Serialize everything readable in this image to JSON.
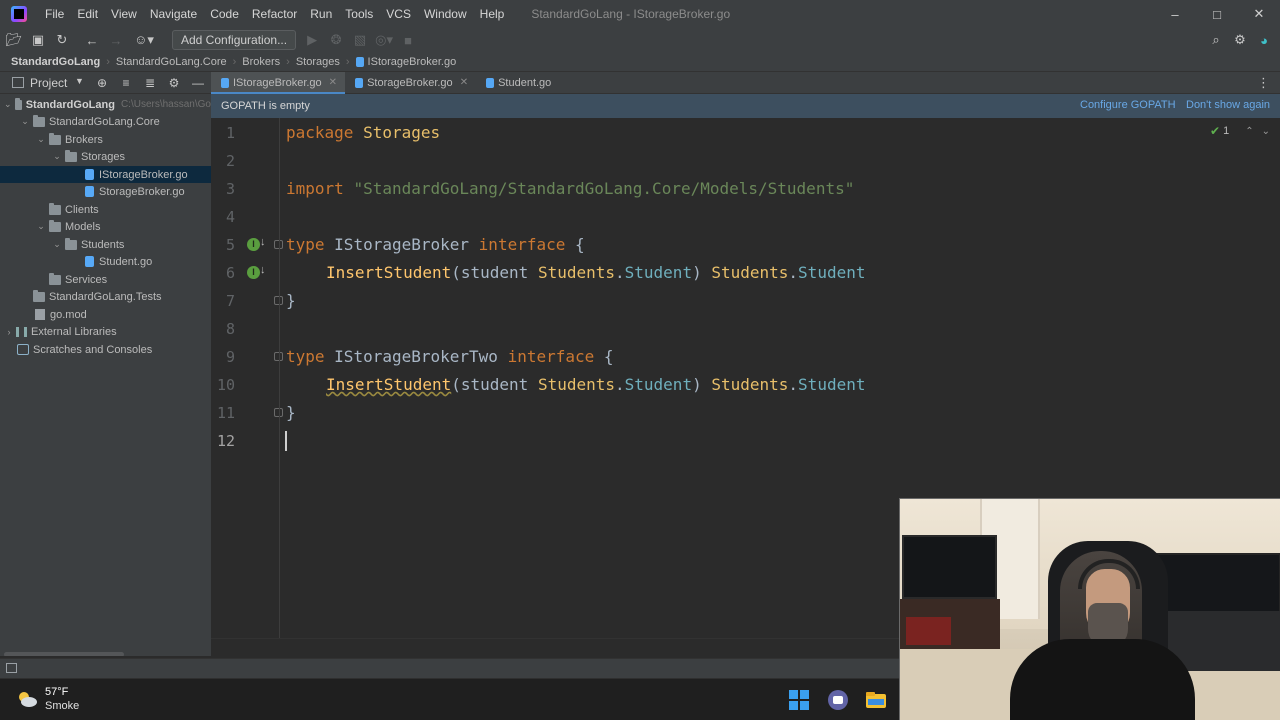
{
  "app": {
    "window_title": "StandardGoLang - IStorageBroker.go",
    "menu": [
      "File",
      "Edit",
      "View",
      "Navigate",
      "Code",
      "Refactor",
      "Run",
      "Tools",
      "VCS",
      "Window",
      "Help"
    ]
  },
  "toolbar": {
    "add_configuration": "Add Configuration..."
  },
  "breadcrumb": [
    "StandardGoLang",
    "StandardGoLang.Core",
    "Brokers",
    "Storages",
    "IStorageBroker.go"
  ],
  "project_panel": {
    "title": "Project",
    "tree": [
      {
        "label": "StandardGoLang",
        "path": "C:\\Users\\hassan\\Go",
        "icon": "folder-icon",
        "expanded": true
      },
      {
        "label": "StandardGoLang.Core",
        "icon": "folder-icon",
        "expanded": true
      },
      {
        "label": "Brokers",
        "icon": "folder-icon",
        "expanded": true
      },
      {
        "label": "Storages",
        "icon": "folder-icon",
        "expanded": true
      },
      {
        "label": "IStorageBroker.go",
        "icon": "go-file-icon",
        "selected": true
      },
      {
        "label": "StorageBroker.go",
        "icon": "go-file-icon"
      },
      {
        "label": "Clients",
        "icon": "folder-icon"
      },
      {
        "label": "Models",
        "icon": "folder-icon",
        "expanded": true
      },
      {
        "label": "Students",
        "icon": "folder-icon",
        "expanded": true
      },
      {
        "label": "Student.go",
        "icon": "go-file-icon"
      },
      {
        "label": "Services",
        "icon": "folder-icon"
      },
      {
        "label": "StandardGoLang.Tests",
        "icon": "folder-icon"
      },
      {
        "label": "go.mod",
        "icon": "mod-file-icon"
      },
      {
        "label": "External Libraries",
        "icon": "library-icon"
      },
      {
        "label": "Scratches and Consoles",
        "icon": "scratches-icon"
      }
    ]
  },
  "tabs": [
    {
      "label": "IStorageBroker.go",
      "active": true
    },
    {
      "label": "StorageBroker.go"
    },
    {
      "label": "Student.go"
    }
  ],
  "notification": {
    "message": "GOPATH is empty",
    "configure": "Configure GOPATH",
    "dismiss": "Don't show again"
  },
  "editor": {
    "line_numbers": [
      "1",
      "2",
      "3",
      "4",
      "5",
      "6",
      "7",
      "8",
      "9",
      "10",
      "11",
      "12"
    ],
    "current_line": "12",
    "inspection_count": "1",
    "code": {
      "l1_kw": "package",
      "l1_name": "Storages",
      "l3_kw": "import",
      "l3_str": "\"StandardGoLang/StandardGoLang.Core/Models/Students\"",
      "l5_kw": "type",
      "l5_name": "IStorageBroker",
      "l5_kw2": "interface",
      "l5_brace": "{",
      "l6_fn": "InsertStudent",
      "l6_open": "(student ",
      "l6_pkg": "Students",
      "l6_dot": ".",
      "l6_type": "Student",
      "l6_close": ") ",
      "l6_rpkg": "Students",
      "l6_rdot": ".",
      "l6_rtype": "Student",
      "l7_brace": "}",
      "l9_kw": "type",
      "l9_name": "IStorageBrokerTwo",
      "l9_kw2": "interface",
      "l9_brace": "{",
      "l10_fn": "InsertStudent",
      "l10_open": "(student ",
      "l10_pkg": "Students",
      "l10_dot": ".",
      "l10_type": "Student",
      "l10_close": ") ",
      "l10_rpkg": "Students",
      "l10_rdot": ".",
      "l10_rtype": "Student",
      "l11_brace": "}"
    }
  },
  "taskbar": {
    "temperature": "57°F",
    "condition": "Smoke"
  },
  "colors": {
    "keyword": "#cc7832",
    "string": "#6a8759",
    "function": "#ffc66d",
    "type": "#6fafbd",
    "accent": "#4a88c7"
  }
}
